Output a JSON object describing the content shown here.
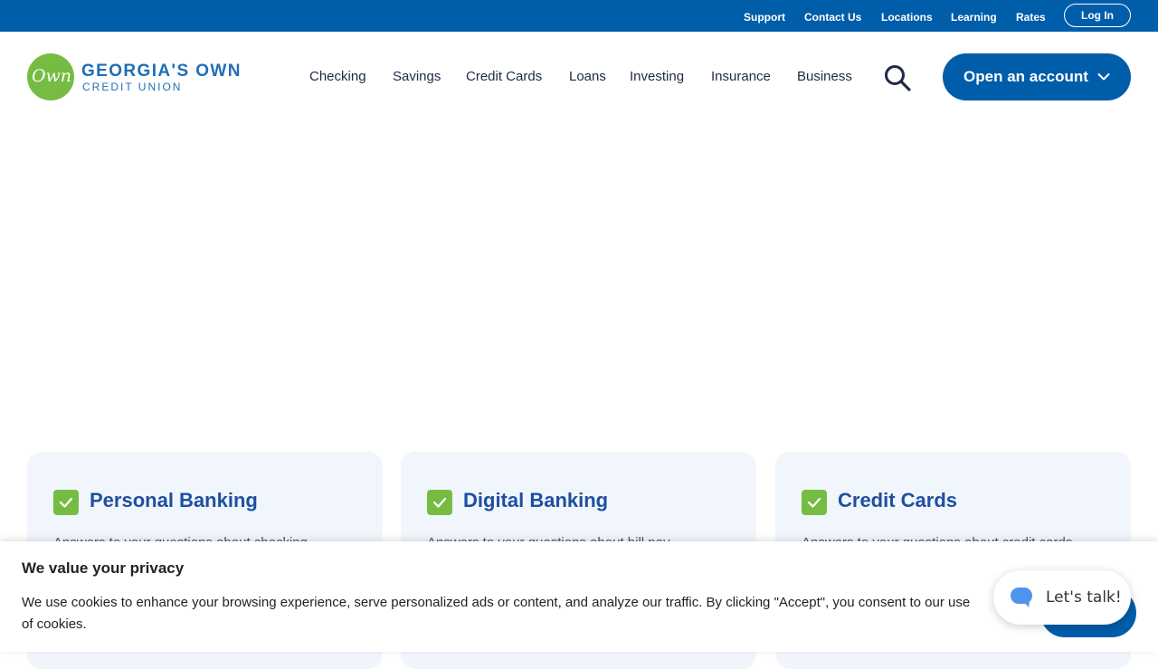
{
  "utility_nav": {
    "links": [
      "Support",
      "Contact Us",
      "Locations",
      "Learning",
      "Rates"
    ],
    "login": "Log In"
  },
  "header": {
    "logo": {
      "mark": "Own",
      "line1": "GEORGIA'S OWN",
      "line2": "CREDIT UNION"
    },
    "nav": [
      "Checking",
      "Savings",
      "Credit Cards",
      "Loans",
      "Investing",
      "Insurance",
      "Business"
    ],
    "search_icon": "search-icon",
    "cta": "Open an account"
  },
  "cards": [
    {
      "title": "Personal Banking",
      "description": "Answers to your questions about checking"
    },
    {
      "title": "Digital Banking",
      "description": "Answers to your questions about bill pay"
    },
    {
      "title": "Credit Cards",
      "description": "Answers to your questions about credit cards"
    }
  ],
  "cookie_banner": {
    "title": "We value your privacy",
    "text": "We use cookies to enhance your browsing experience, serve personalized ads or content, and analyze our traffic. By clicking \"Accept\", you consent to our use of cookies."
  },
  "chat": {
    "label": "Let's talk!",
    "icon": "chat-bubble-icon"
  },
  "colors": {
    "brand_blue": "#005daa",
    "brand_green": "#76bc43",
    "card_title": "#1f4fa0",
    "card_bg": "#f1f6fc"
  }
}
